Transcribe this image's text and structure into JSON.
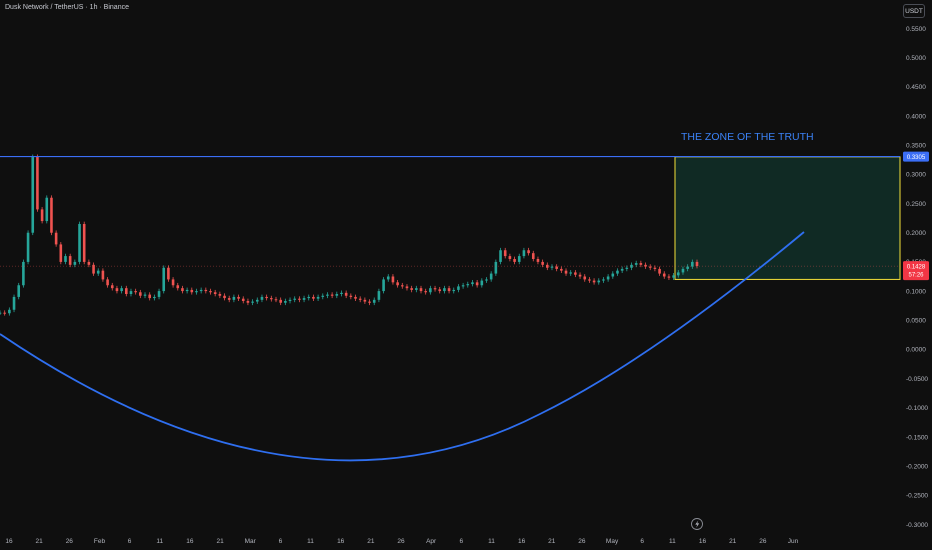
{
  "header": {
    "symbol_title": "Dusk Network / TetherUS · 1h · Binance",
    "unit_button": "USDT"
  },
  "chart_data": {
    "type": "line",
    "ylim": [
      -0.3,
      0.55
    ],
    "y_ticks": [
      "0.5500",
      "0.5000",
      "0.4500",
      "0.4000",
      "0.3500",
      "0.3000",
      "0.2500",
      "0.2000",
      "0.1500",
      "0.1000",
      "0.0500",
      "0.0000",
      "-0.0500",
      "-0.1000",
      "-0.1500",
      "-0.2000",
      "-0.2500",
      "-0.3000"
    ],
    "x_ticks": [
      "16",
      "21",
      "26",
      "Feb",
      "6",
      "11",
      "16",
      "21",
      "Mar",
      "6",
      "11",
      "16",
      "21",
      "26",
      "Apr",
      "6",
      "11",
      "16",
      "21",
      "26",
      "May",
      "6",
      "11",
      "16",
      "21",
      "26",
      "Jun"
    ],
    "series": [
      {
        "values": [
          0.063,
          0.062,
          0.068,
          0.09,
          0.11,
          0.15,
          0.2,
          0.33,
          0.24,
          0.22,
          0.26,
          0.2,
          0.18,
          0.15,
          0.16,
          0.145,
          0.15,
          0.215,
          0.15,
          0.145,
          0.13,
          0.135,
          0.12,
          0.11,
          0.105,
          0.1,
          0.105,
          0.095,
          0.1,
          0.098,
          0.092,
          0.094,
          0.088,
          0.09,
          0.1,
          0.14,
          0.12,
          0.11,
          0.105,
          0.1,
          0.102,
          0.098,
          0.1,
          0.102,
          0.1,
          0.098,
          0.095,
          0.092,
          0.088,
          0.085,
          0.09,
          0.087,
          0.083,
          0.08,
          0.082,
          0.085,
          0.09,
          0.088,
          0.086,
          0.085,
          0.08,
          0.083,
          0.085,
          0.087,
          0.085,
          0.088,
          0.09,
          0.087,
          0.09,
          0.092,
          0.094,
          0.092,
          0.095,
          0.097,
          0.092,
          0.09,
          0.087,
          0.085,
          0.082,
          0.08,
          0.085,
          0.1,
          0.12,
          0.125,
          0.115,
          0.11,
          0.108,
          0.105,
          0.102,
          0.105,
          0.1,
          0.098,
          0.105,
          0.103,
          0.1,
          0.105,
          0.1,
          0.102,
          0.108,
          0.11,
          0.112,
          0.115,
          0.11,
          0.118,
          0.12,
          0.13,
          0.15,
          0.17,
          0.16,
          0.155,
          0.15,
          0.16,
          0.17,
          0.165,
          0.155,
          0.15,
          0.145,
          0.14,
          0.142,
          0.138,
          0.135,
          0.13,
          0.132,
          0.128,
          0.125,
          0.12,
          0.118,
          0.115,
          0.118,
          0.12,
          0.125,
          0.13,
          0.135,
          0.138,
          0.14,
          0.145,
          0.148,
          0.145,
          0.142,
          0.14,
          0.138,
          0.13,
          0.125,
          0.123,
          0.127,
          0.132,
          0.138,
          0.142,
          0.15,
          0.143
        ]
      }
    ],
    "annotations": {
      "zone_label": "THE ZONE OF THE TRUTH",
      "resistance_price": "0.3305",
      "current_price": "0.1428",
      "countdown": "57:26",
      "resistance_value": 0.3305,
      "current_value": 0.1428,
      "zone_range": [
        0.12,
        0.33
      ]
    },
    "colors": {
      "background": "#0f0f0f",
      "up": "#26a69a",
      "down": "#ef5350",
      "resistance_line": "#3b6ef6",
      "arc": "#2f6ff0",
      "zone_fill": "#102a24",
      "zone_border": "#f5e23a",
      "current_badge": "#f23645"
    }
  }
}
